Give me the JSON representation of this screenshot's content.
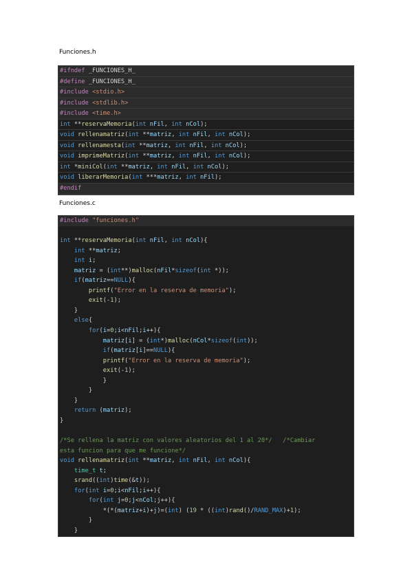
{
  "header_title": "Funciones.h",
  "source_title": "Funciones.c",
  "header_code": [
    [
      [
        "pp-k",
        "#ifndef"
      ],
      [
        "pun",
        " _FUNCIONES_H_"
      ]
    ],
    [
      [
        "pp-k",
        "#define"
      ],
      [
        "pun",
        " _FUNCIONES_H_"
      ]
    ],
    [
      [
        "pp-k",
        "#include"
      ],
      [
        "str",
        " <stdio.h>"
      ]
    ],
    [
      [
        "pp-k",
        "#include"
      ],
      [
        "str",
        " <stdlib.h>"
      ]
    ],
    [
      [
        "pp-k",
        "#include"
      ],
      [
        "str",
        " <time.h>"
      ]
    ],
    [
      [
        "kw",
        "int"
      ],
      [
        "pun",
        " **"
      ],
      [
        "fn",
        "reservaMemoria"
      ],
      [
        "pun",
        "("
      ],
      [
        "kw",
        "int"
      ],
      [
        "var",
        " nFil"
      ],
      [
        "pun",
        ", "
      ],
      [
        "kw",
        "int"
      ],
      [
        "var",
        " nCol"
      ],
      [
        "pun",
        ");"
      ]
    ],
    [
      [
        "kw",
        "void"
      ],
      [
        "fn",
        " rellenamatriz"
      ],
      [
        "pun",
        "("
      ],
      [
        "kw",
        "int"
      ],
      [
        "pun",
        " **"
      ],
      [
        "var",
        "matriz"
      ],
      [
        "pun",
        ", "
      ],
      [
        "kw",
        "int"
      ],
      [
        "var",
        " nFil"
      ],
      [
        "pun",
        ", "
      ],
      [
        "kw",
        "int"
      ],
      [
        "var",
        " nCol"
      ],
      [
        "pun",
        ");"
      ]
    ],
    [
      [
        "kw",
        "void"
      ],
      [
        "fn",
        " rellenamesta"
      ],
      [
        "pun",
        "("
      ],
      [
        "kw",
        "int"
      ],
      [
        "pun",
        " **"
      ],
      [
        "var",
        "matriz"
      ],
      [
        "pun",
        ", "
      ],
      [
        "kw",
        "int"
      ],
      [
        "var",
        " nFil"
      ],
      [
        "pun",
        ", "
      ],
      [
        "kw",
        "int"
      ],
      [
        "var",
        " nCol"
      ],
      [
        "pun",
        ");"
      ]
    ],
    [
      [
        "kw",
        "void"
      ],
      [
        "fn",
        " imprimeMatriz"
      ],
      [
        "pun",
        "("
      ],
      [
        "kw",
        "int"
      ],
      [
        "pun",
        " **"
      ],
      [
        "var",
        "matriz"
      ],
      [
        "pun",
        ", "
      ],
      [
        "kw",
        "int"
      ],
      [
        "var",
        " nFil"
      ],
      [
        "pun",
        ", "
      ],
      [
        "kw",
        "int"
      ],
      [
        "var",
        " nCol"
      ],
      [
        "pun",
        ");"
      ]
    ],
    [
      [
        "kw",
        "int"
      ],
      [
        "pun",
        " *"
      ],
      [
        "fn",
        "miniCol"
      ],
      [
        "pun",
        "("
      ],
      [
        "kw",
        "int"
      ],
      [
        "pun",
        " **"
      ],
      [
        "var",
        "matriz"
      ],
      [
        "pun",
        ", "
      ],
      [
        "kw",
        "int"
      ],
      [
        "var",
        " nFil"
      ],
      [
        "pun",
        ", "
      ],
      [
        "kw",
        "int"
      ],
      [
        "var",
        " nCol"
      ],
      [
        "pun",
        ");"
      ]
    ],
    [
      [
        "kw",
        "void"
      ],
      [
        "fn",
        " liberarMemoria"
      ],
      [
        "pun",
        "("
      ],
      [
        "kw",
        "int"
      ],
      [
        "pun",
        " ***"
      ],
      [
        "var",
        "matriz"
      ],
      [
        "pun",
        ", "
      ],
      [
        "kw",
        "int"
      ],
      [
        "var",
        " nFil"
      ],
      [
        "pun",
        ");"
      ]
    ],
    [
      [
        "pp-k",
        "#endif"
      ]
    ]
  ],
  "source_code": [
    [
      [
        "pp-k",
        "#include"
      ],
      [
        "str",
        " \"funciones.h\""
      ]
    ],
    [],
    [
      [
        "kw",
        "int"
      ],
      [
        "pun",
        " **"
      ],
      [
        "fn",
        "reservaMemoria"
      ],
      [
        "pun",
        "("
      ],
      [
        "kw",
        "int"
      ],
      [
        "var",
        " nFil"
      ],
      [
        "pun",
        ", "
      ],
      [
        "kw",
        "int"
      ],
      [
        "var",
        " nCol"
      ],
      [
        "pun",
        "){"
      ]
    ],
    [
      [
        "pun",
        "    "
      ],
      [
        "kw",
        "int"
      ],
      [
        "pun",
        " **"
      ],
      [
        "var",
        "matriz"
      ],
      [
        "pun",
        ";"
      ]
    ],
    [
      [
        "pun",
        "    "
      ],
      [
        "kw",
        "int"
      ],
      [
        "var",
        " i"
      ],
      [
        "pun",
        ";"
      ]
    ],
    [
      [
        "pun",
        "    "
      ],
      [
        "var",
        "matriz"
      ],
      [
        "pun",
        " = ("
      ],
      [
        "kw",
        "int"
      ],
      [
        "pun",
        "**)"
      ],
      [
        "fn",
        "malloc"
      ],
      [
        "pun",
        "("
      ],
      [
        "var",
        "nFil"
      ],
      [
        "pun",
        "*"
      ],
      [
        "kw",
        "sizeof"
      ],
      [
        "pun",
        "("
      ],
      [
        "kw",
        "int"
      ],
      [
        "pun",
        " *));"
      ]
    ],
    [
      [
        "pun",
        "    "
      ],
      [
        "kw",
        "if"
      ],
      [
        "pun",
        "("
      ],
      [
        "var",
        "matriz"
      ],
      [
        "pun",
        "=="
      ],
      [
        "mac",
        "NULL"
      ],
      [
        "pun",
        "){"
      ]
    ],
    [
      [
        "pun",
        "        "
      ],
      [
        "fn",
        "printf"
      ],
      [
        "pun",
        "("
      ],
      [
        "str",
        "\"Error en la reserva de memoria\""
      ],
      [
        "pun",
        ");"
      ]
    ],
    [
      [
        "pun",
        "        "
      ],
      [
        "fn",
        "exit"
      ],
      [
        "pun",
        "(-"
      ],
      [
        "num",
        "1"
      ],
      [
        "pun",
        ");"
      ]
    ],
    [
      [
        "pun",
        "    }"
      ]
    ],
    [
      [
        "pun",
        "    "
      ],
      [
        "kw",
        "else"
      ],
      [
        "pun",
        "{"
      ]
    ],
    [
      [
        "pun",
        "        "
      ],
      [
        "kw",
        "for"
      ],
      [
        "pun",
        "("
      ],
      [
        "var",
        "i"
      ],
      [
        "pun",
        "="
      ],
      [
        "num",
        "0"
      ],
      [
        "pun",
        ";"
      ],
      [
        "var",
        "i"
      ],
      [
        "pun",
        "<"
      ],
      [
        "var",
        "nFil"
      ],
      [
        "pun",
        ";"
      ],
      [
        "var",
        "i"
      ],
      [
        "pun",
        "++){"
      ]
    ],
    [
      [
        "pun",
        "            "
      ],
      [
        "var",
        "matriz"
      ],
      [
        "pun",
        "["
      ],
      [
        "var",
        "i"
      ],
      [
        "pun",
        "] = ("
      ],
      [
        "kw",
        "int"
      ],
      [
        "pun",
        "*)"
      ],
      [
        "fn",
        "malloc"
      ],
      [
        "pun",
        "("
      ],
      [
        "var",
        "nCol"
      ],
      [
        "pun",
        "*"
      ],
      [
        "kw",
        "sizeof"
      ],
      [
        "pun",
        "("
      ],
      [
        "kw",
        "int"
      ],
      [
        "pun",
        "));"
      ]
    ],
    [
      [
        "pun",
        "            "
      ],
      [
        "kw",
        "if"
      ],
      [
        "pun",
        "("
      ],
      [
        "var",
        "matriz"
      ],
      [
        "pun",
        "["
      ],
      [
        "var",
        "i"
      ],
      [
        "pun",
        "]=="
      ],
      [
        "mac",
        "NULL"
      ],
      [
        "pun",
        "){"
      ]
    ],
    [
      [
        "pun",
        "            "
      ],
      [
        "fn",
        "printf"
      ],
      [
        "pun",
        "("
      ],
      [
        "str",
        "\"Error en la reserva de memoria\""
      ],
      [
        "pun",
        ");"
      ]
    ],
    [
      [
        "pun",
        "            "
      ],
      [
        "fn",
        "exit"
      ],
      [
        "pun",
        "(-"
      ],
      [
        "num",
        "1"
      ],
      [
        "pun",
        ");"
      ]
    ],
    [
      [
        "pun",
        "            }"
      ]
    ],
    [
      [
        "pun",
        "        }"
      ]
    ],
    [
      [
        "pun",
        "    }"
      ]
    ],
    [
      [
        "pun",
        "    "
      ],
      [
        "kw",
        "return"
      ],
      [
        "pun",
        " ("
      ],
      [
        "var",
        "matriz"
      ],
      [
        "pun",
        ");"
      ]
    ],
    [
      [
        "pun",
        "}"
      ]
    ],
    [],
    [
      [
        "cm",
        "/*Se rellena la matriz con valores aleatorios del 1 al 20*/   /*Cambiar"
      ]
    ],
    [
      [
        "cm",
        "esta funcion para que me funcione*/"
      ]
    ],
    [
      [
        "kw",
        "void"
      ],
      [
        "fn",
        " rellenamatriz"
      ],
      [
        "pun",
        "("
      ],
      [
        "kw",
        "int"
      ],
      [
        "pun",
        " **"
      ],
      [
        "var",
        "matriz"
      ],
      [
        "pun",
        ", "
      ],
      [
        "kw",
        "int"
      ],
      [
        "var",
        " nFil"
      ],
      [
        "pun",
        ", "
      ],
      [
        "kw",
        "int"
      ],
      [
        "var",
        " nCol"
      ],
      [
        "pun",
        "){"
      ]
    ],
    [
      [
        "pun",
        "    "
      ],
      [
        "ty",
        "time_t"
      ],
      [
        "var",
        " t"
      ],
      [
        "pun",
        ";"
      ]
    ],
    [
      [
        "pun",
        "    "
      ],
      [
        "fn",
        "srand"
      ],
      [
        "pun",
        "(("
      ],
      [
        "kw",
        "int"
      ],
      [
        "pun",
        ")"
      ],
      [
        "fn",
        "time"
      ],
      [
        "pun",
        "(&"
      ],
      [
        "var",
        "t"
      ],
      [
        "pun",
        "));"
      ]
    ],
    [
      [
        "pun",
        "    "
      ],
      [
        "kw",
        "for"
      ],
      [
        "pun",
        "("
      ],
      [
        "kw",
        "int"
      ],
      [
        "var",
        " i"
      ],
      [
        "pun",
        "="
      ],
      [
        "num",
        "0"
      ],
      [
        "pun",
        ";"
      ],
      [
        "var",
        "i"
      ],
      [
        "pun",
        "<"
      ],
      [
        "var",
        "nFil"
      ],
      [
        "pun",
        ";"
      ],
      [
        "var",
        "i"
      ],
      [
        "pun",
        "++){"
      ]
    ],
    [
      [
        "pun",
        "        "
      ],
      [
        "kw",
        "for"
      ],
      [
        "pun",
        "("
      ],
      [
        "kw",
        "int"
      ],
      [
        "var",
        " j"
      ],
      [
        "pun",
        "="
      ],
      [
        "num",
        "0"
      ],
      [
        "pun",
        ";"
      ],
      [
        "var",
        "j"
      ],
      [
        "pun",
        "<"
      ],
      [
        "var",
        "nCol"
      ],
      [
        "pun",
        ";"
      ],
      [
        "var",
        "j"
      ],
      [
        "pun",
        "++){"
      ]
    ],
    [
      [
        "pun",
        "            *(*("
      ],
      [
        "var",
        "matriz"
      ],
      [
        "pun",
        "+"
      ],
      [
        "var",
        "i"
      ],
      [
        "pun",
        ")+"
      ],
      [
        "var",
        "j"
      ],
      [
        "pun",
        ")=("
      ],
      [
        "kw",
        "int"
      ],
      [
        "pun",
        ") ("
      ],
      [
        "num",
        "19"
      ],
      [
        "pun",
        " * (("
      ],
      [
        "kw",
        "int"
      ],
      [
        "pun",
        ")"
      ],
      [
        "fn",
        "rand"
      ],
      [
        "pun",
        "()/"
      ],
      [
        "mac",
        "RAND_MAX"
      ],
      [
        "pun",
        ")+"
      ],
      [
        "num",
        "1"
      ],
      [
        "pun",
        ");"
      ]
    ],
    [
      [
        "pun",
        "        }"
      ]
    ],
    [
      [
        "pun",
        "    }"
      ]
    ]
  ]
}
